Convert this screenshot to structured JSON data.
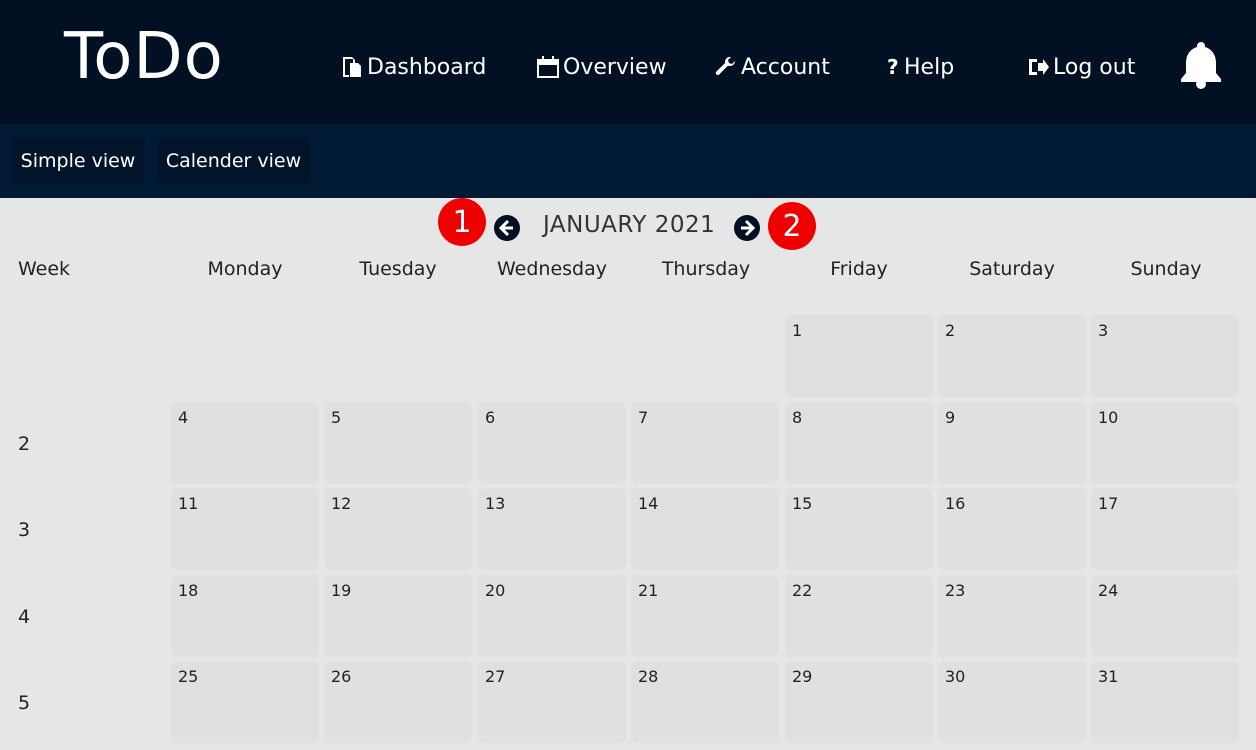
{
  "app": {
    "title": "ToDo"
  },
  "nav": [
    {
      "label": "Dashboard",
      "icon": "document-icon"
    },
    {
      "label": "Overview",
      "icon": "calendar-icon"
    },
    {
      "label": "Account",
      "icon": "wrench-icon"
    },
    {
      "label": "Help",
      "icon": "question-icon"
    },
    {
      "label": "Log out",
      "icon": "logout-icon"
    }
  ],
  "notifications": {
    "icon": "bell-icon"
  },
  "views": {
    "simple": "Simple view",
    "calendar": "Calender view"
  },
  "calendar": {
    "month_label": "JANUARY 2021",
    "prev_icon": "arrow-left-icon",
    "next_icon": "arrow-right-icon",
    "markers": [
      "1",
      "2"
    ],
    "week_header": "Week",
    "days": [
      "Monday",
      "Tuesday",
      "Wednesday",
      "Thursday",
      "Friday",
      "Saturday",
      "Sunday"
    ],
    "weeks": [
      {
        "number": "",
        "dates": [
          "",
          "",
          "",
          "",
          "1",
          "2",
          "3"
        ]
      },
      {
        "number": "2",
        "dates": [
          "4",
          "5",
          "6",
          "7",
          "8",
          "9",
          "10"
        ]
      },
      {
        "number": "3",
        "dates": [
          "11",
          "12",
          "13",
          "14",
          "15",
          "16",
          "17"
        ]
      },
      {
        "number": "4",
        "dates": [
          "18",
          "19",
          "20",
          "21",
          "22",
          "23",
          "24"
        ]
      },
      {
        "number": "5",
        "dates": [
          "25",
          "26",
          "27",
          "28",
          "29",
          "30",
          "31"
        ]
      }
    ]
  },
  "colors": {
    "header_bg": "#011023",
    "subbar_bg": "#011a33",
    "marker": "#ee0000",
    "page_bg": "#e6e6e6"
  }
}
